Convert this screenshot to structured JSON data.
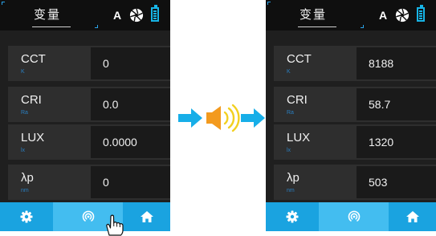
{
  "panels": [
    {
      "header": {
        "title": "变量",
        "mode_label": "A",
        "icons": [
          "aperture-icon",
          "battery-icon"
        ]
      },
      "rows": [
        {
          "label": "CCT",
          "unit": "K",
          "value": "0"
        },
        {
          "label": "CRI",
          "unit": "Ra",
          "value": "0.0"
        },
        {
          "label": "LUX",
          "unit": "lx",
          "value": "0.0000"
        },
        {
          "label": "λp",
          "unit": "nm",
          "value": "0"
        }
      ],
      "footer": {
        "buttons": [
          "settings-icon",
          "measure-icon",
          "home-icon"
        ],
        "pressed": "measure-icon"
      }
    },
    {
      "header": {
        "title": "变量",
        "mode_label": "A",
        "icons": [
          "aperture-icon",
          "battery-icon"
        ]
      },
      "rows": [
        {
          "label": "CCT",
          "unit": "K",
          "value": "8188"
        },
        {
          "label": "CRI",
          "unit": "Ra",
          "value": "58.7"
        },
        {
          "label": "LUX",
          "unit": "lx",
          "value": "1320"
        },
        {
          "label": "λp",
          "unit": "nm",
          "value": "503"
        }
      ],
      "footer": {
        "buttons": [
          "settings-icon",
          "measure-icon",
          "home-icon"
        ]
      }
    }
  ],
  "flow_icons": [
    "right-arrow-icon",
    "speaker-icon",
    "right-arrow-icon"
  ],
  "colors": {
    "accent_blue": "#1aa3e0",
    "active_blue": "#43bdf0",
    "speaker_orange": "#f39a1e",
    "sound_wave_yellow": "#f2d020"
  }
}
